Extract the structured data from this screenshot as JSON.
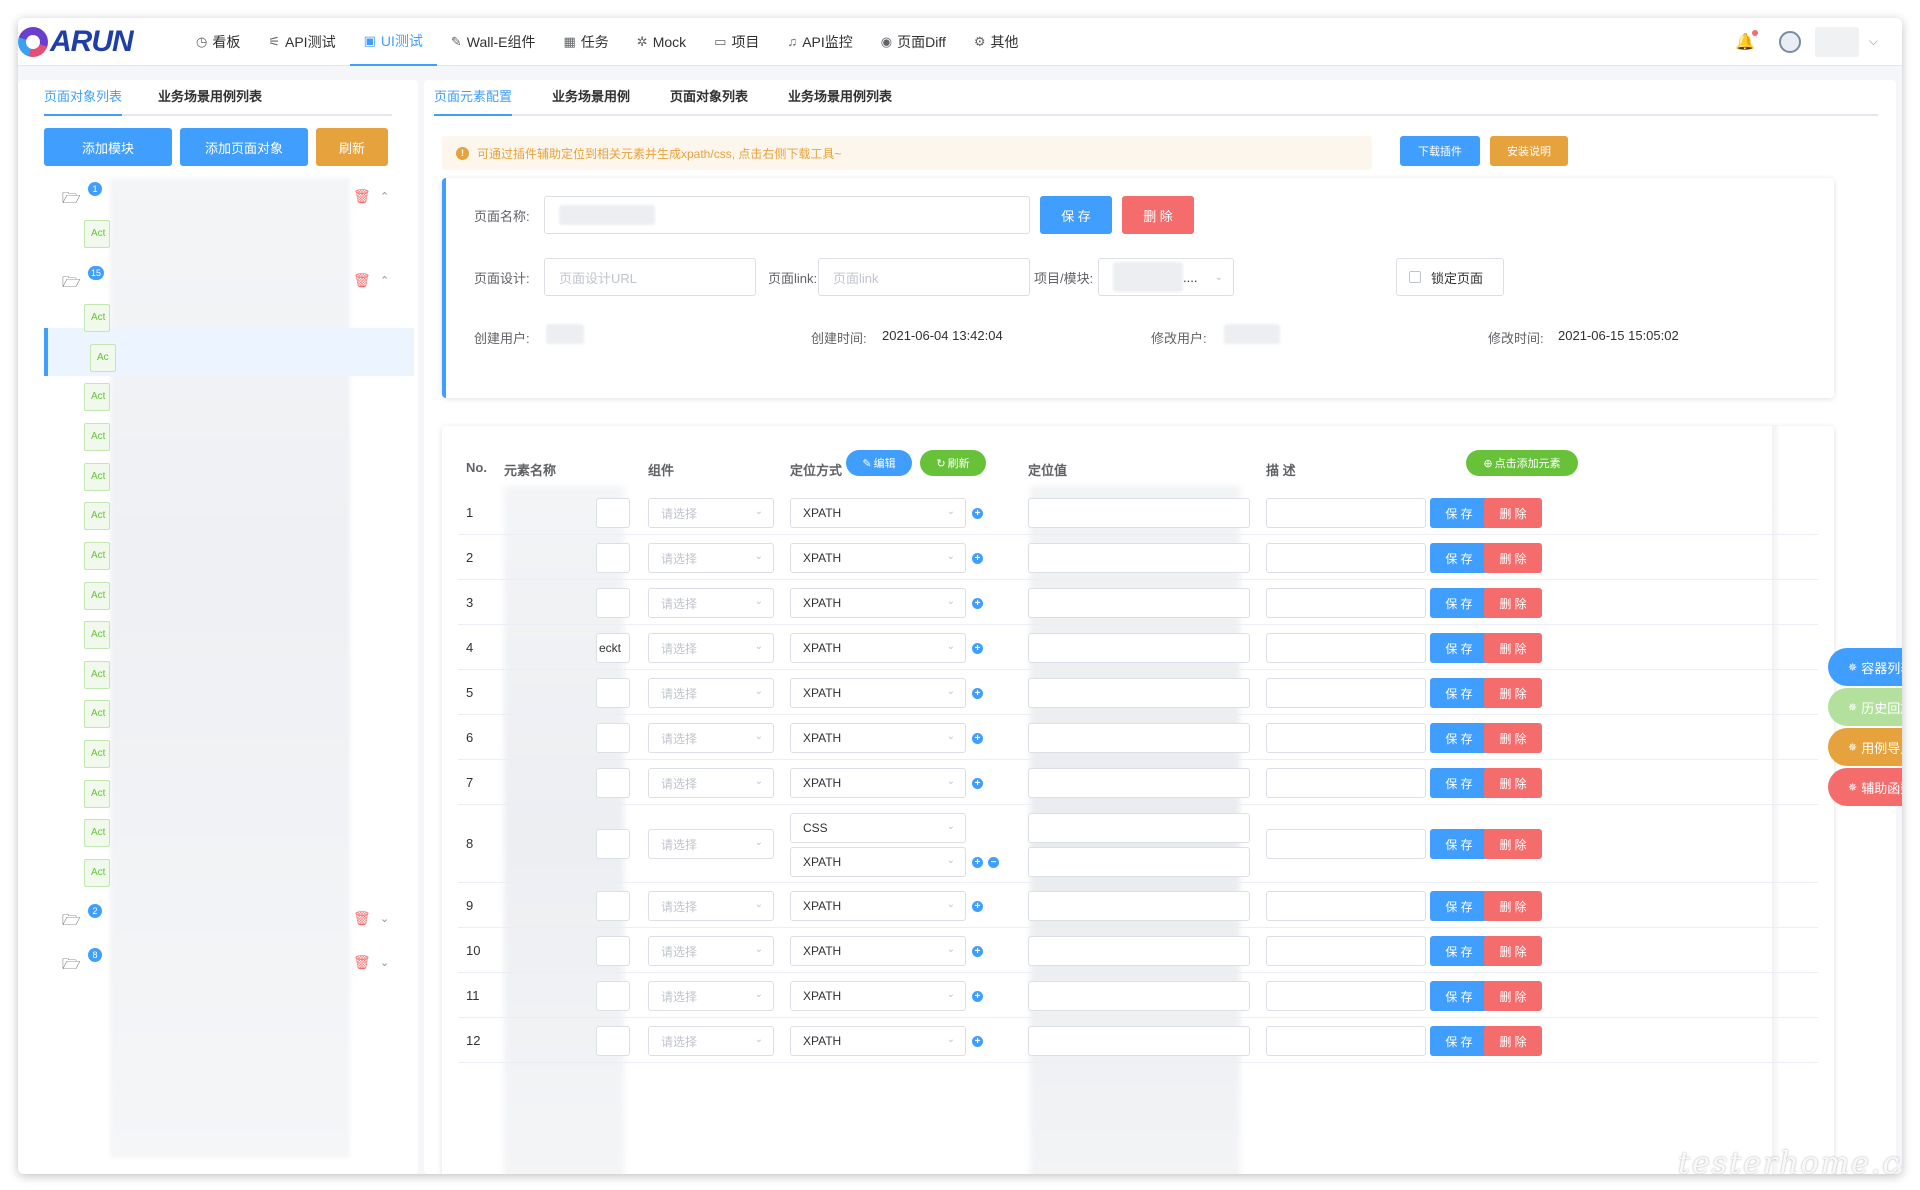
{
  "app": {
    "logo_text": "ARUN",
    "nav": [
      {
        "icon": "◷",
        "label": "看板"
      },
      {
        "icon": "⚟",
        "label": "API测试"
      },
      {
        "icon": "▣",
        "label": "UI测试"
      },
      {
        "icon": "✎",
        "label": "Wall-E组件"
      },
      {
        "icon": "▦",
        "label": "任务"
      },
      {
        "icon": "✲",
        "label": "Mock"
      },
      {
        "icon": "▭",
        "label": "项目"
      },
      {
        "icon": "♫",
        "label": "API监控"
      },
      {
        "icon": "◉",
        "label": "页面Diff"
      },
      {
        "icon": "⚙",
        "label": "其他"
      }
    ],
    "active_nav": "UI测试"
  },
  "left": {
    "tabs": [
      "页面对象列表",
      "业务场景用例列表"
    ],
    "buttons": {
      "add_module": "添加模块",
      "add_page_object": "添加页面对象",
      "refresh": "刷新"
    },
    "folders": [
      {
        "badge": "1"
      },
      {
        "badge": "15"
      },
      {
        "badge": "2"
      },
      {
        "badge": "8"
      }
    ],
    "leaf_label": "Act",
    "selected_leaf_label": "Ac"
  },
  "right": {
    "tabs": [
      "页面元素配置",
      "业务场景用例",
      "页面对象列表",
      "业务场景用例列表"
    ],
    "notice": "可通过插件辅助定位到相关元素并生成xpath/css, 点击右侧下载工具~",
    "download_plugin": "下载插件",
    "install_guide": "安装说明",
    "form": {
      "page_name_label": "页面名称:",
      "save": "保 存",
      "delete": "删 除",
      "design_label": "页面设计:",
      "design_placeholder": "页面设计URL",
      "link_label": "页面link:",
      "link_placeholder": "页面link",
      "module_label": "项目/模块:",
      "module_suffix": "....",
      "lock_label": "锁定页面",
      "created_by_label": "创建用户:",
      "created_at_label": "创建时间:",
      "created_at": "2021-06-04 13:42:04",
      "modified_by_label": "修改用户:",
      "modified_at_label": "修改时间:",
      "modified_at": "2021-06-15 15:05:02"
    },
    "table": {
      "headers": {
        "no": "No.",
        "name": "元素名称",
        "component": "组件",
        "locate_by": "定位方式",
        "locator": "定位值",
        "desc": "描 述"
      },
      "edit_pill": "编辑",
      "refresh_pill": "刷新",
      "add_element": "点击添加元素",
      "component_placeholder": "请选择",
      "row_save": "保 存",
      "row_delete": "删 除",
      "rows": [
        {
          "no": "1",
          "name_suffix": "",
          "locate": [
            "XPATH"
          ]
        },
        {
          "no": "2",
          "name_suffix": "",
          "locate": [
            "XPATH"
          ]
        },
        {
          "no": "3",
          "name_suffix": "",
          "locate": [
            "XPATH"
          ]
        },
        {
          "no": "4",
          "name_suffix": "eckt",
          "locate": [
            "XPATH"
          ]
        },
        {
          "no": "5",
          "name_suffix": "",
          "locate": [
            "XPATH"
          ]
        },
        {
          "no": "6",
          "name_suffix": "",
          "locate": [
            "XPATH"
          ]
        },
        {
          "no": "7",
          "name_suffix": "",
          "locate": [
            "XPATH"
          ]
        },
        {
          "no": "8",
          "name_suffix": "",
          "locate": [
            "CSS",
            "XPATH"
          ]
        },
        {
          "no": "9",
          "name_suffix": "",
          "locate": [
            "XPATH"
          ]
        },
        {
          "no": "10",
          "name_suffix": "",
          "locate": [
            "XPATH"
          ]
        },
        {
          "no": "11",
          "name_suffix": "",
          "locate": [
            "XPATH"
          ]
        },
        {
          "no": "12",
          "name_suffix": "",
          "locate": [
            "XPATH"
          ]
        }
      ]
    }
  },
  "floating": [
    {
      "label": "容器列表",
      "color": "#409eff"
    },
    {
      "label": "历史回放",
      "color": "#b3e19d"
    },
    {
      "label": "用例导入",
      "color": "#e6a23c"
    },
    {
      "label": "辅助函数",
      "color": "#f56c6c"
    }
  ],
  "watermark": "testerhome.com"
}
